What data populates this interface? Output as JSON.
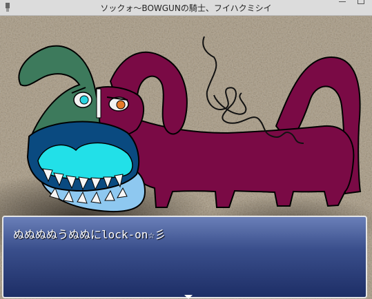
{
  "window": {
    "title": "ソックォ〜BOWGUNの騎士、フイハクミシイ"
  },
  "message": {
    "text": "ぬぬぬぬうぬぬにlock-on☆彡"
  },
  "colors": {
    "monster_body": "#7a0a45",
    "monster_head": "#3d7a5c",
    "mouth": "#0a4a80",
    "teeth_gum": "#22e0e8",
    "tongue": "#8ec8f0",
    "msgbox_top": "#6a7fb8",
    "msgbox_bottom": "#1d2e66"
  }
}
